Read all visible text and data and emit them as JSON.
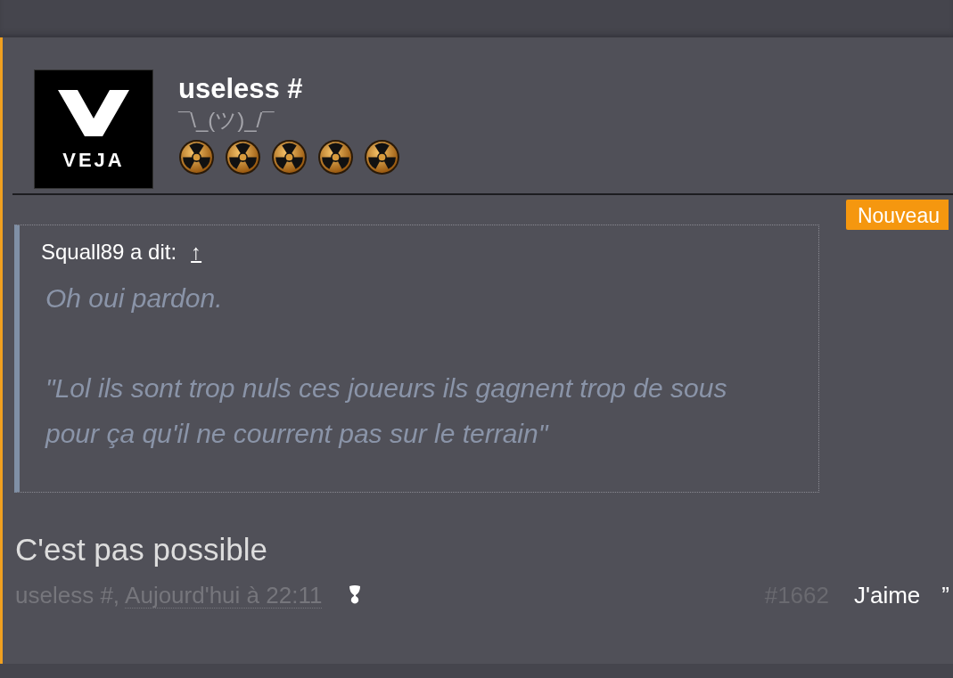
{
  "post": {
    "avatar": {
      "text": "VEJA"
    },
    "author": "useless #",
    "user_title": "¯\\_(ツ)_/¯",
    "badge": "Nouveau",
    "quote": {
      "attribution": "Squall89 a dit:",
      "jump": "↑",
      "paragraphs": [
        "Oh oui pardon.",
        "\"Lol ils sont trop nuls ces joueurs ils gagnent trop de sous pour ça qu'il ne courrent pas sur le terrain\""
      ]
    },
    "message": "C'est pas possible",
    "footer": {
      "author": "useless #,",
      "date": "Aujourd'hui à 22:11",
      "number": "#1662",
      "like": "J'aime",
      "quote": "”"
    }
  }
}
